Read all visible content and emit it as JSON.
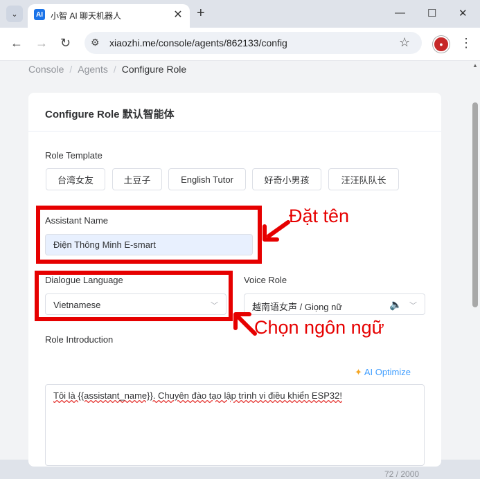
{
  "browser": {
    "tab_title": "小智 AI 聊天机器人",
    "favicon_text": "AI",
    "url": "xiaozhi.me/console/agents/862133/config"
  },
  "breadcrumb": [
    "Console",
    "Agents",
    "Configure Role"
  ],
  "card_title": "Configure Role 默认智能体",
  "role_template": {
    "label": "Role Template",
    "options": [
      "台湾女友",
      "土豆子",
      "English Tutor",
      "好奇小男孩",
      "汪汪队队长"
    ]
  },
  "assistant_name": {
    "label": "Assistant Name",
    "value": "Điện Thông Minh E-smart"
  },
  "dialogue_language": {
    "label": "Dialogue Language",
    "value": "Vietnamese"
  },
  "voice_role": {
    "label": "Voice Role",
    "value": "越南语女声 / Giọng nữ"
  },
  "role_introduction": {
    "label": "Role Introduction",
    "ai_optimize": "AI Optimize",
    "value": "Tôi là {{assistant_name}}. Chuyên đào tạo lập trình vi điều khiển ESP32!",
    "counter": "72 / 2000"
  },
  "annotations": {
    "name_note": "Đặt tên",
    "language_note": "Chọn ngôn ngữ"
  },
  "colors": {
    "accent": "#409eff",
    "highlight": "#e60000"
  }
}
